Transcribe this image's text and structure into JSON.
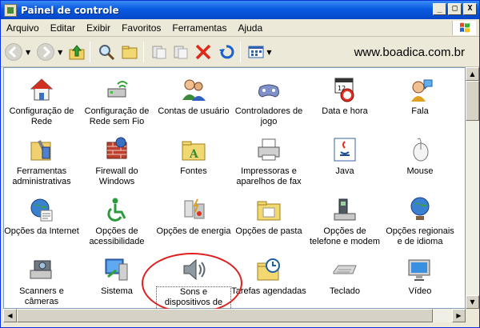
{
  "window": {
    "title": "Painel de controle",
    "minimize": "_",
    "maximize": "□",
    "close": "X"
  },
  "menu": [
    "Arquivo",
    "Editar",
    "Exibir",
    "Favoritos",
    "Ferramentas",
    "Ajuda"
  ],
  "watermark": "www.boadica.com.br",
  "colors": {
    "title_bar": "#0a5ae0",
    "highlight_circle": "#e02020"
  },
  "items": [
    {
      "label": "Configuração de Rede",
      "icon": "network-house-icon"
    },
    {
      "label": "Configuração de Rede sem Fio",
      "icon": "wireless-network-icon"
    },
    {
      "label": "Contas de usuário",
      "icon": "users-icon"
    },
    {
      "label": "Controladores de jogo",
      "icon": "gamepad-icon"
    },
    {
      "label": "Data e hora",
      "icon": "calendar-clock-icon"
    },
    {
      "label": "Fala",
      "icon": "speech-icon"
    },
    {
      "label": "Ferramentas administrativas",
      "icon": "admin-tools-icon"
    },
    {
      "label": "Firewall do Windows",
      "icon": "firewall-icon"
    },
    {
      "label": "Fontes",
      "icon": "fonts-folder-icon"
    },
    {
      "label": "Impressoras e aparelhos de fax",
      "icon": "printer-icon"
    },
    {
      "label": "Java",
      "icon": "java-icon"
    },
    {
      "label": "Mouse",
      "icon": "mouse-icon"
    },
    {
      "label": "Opções da Internet",
      "icon": "internet-globe-icon"
    },
    {
      "label": "Opções de acessibilidade",
      "icon": "accessibility-icon"
    },
    {
      "label": "Opções de energia",
      "icon": "power-icon"
    },
    {
      "label": "Opções de pasta",
      "icon": "folder-options-icon"
    },
    {
      "label": "Opções de telefone e modem",
      "icon": "phone-modem-icon"
    },
    {
      "label": "Opções regionais e de idioma",
      "icon": "regional-globe-icon"
    },
    {
      "label": "Scanners e câmeras",
      "icon": "scanner-camera-icon"
    },
    {
      "label": "Sistema",
      "icon": "system-icon"
    },
    {
      "label": "Sons e dispositivos de áudio",
      "icon": "speaker-icon"
    },
    {
      "label": "Tarefas agendadas",
      "icon": "scheduled-tasks-icon"
    },
    {
      "label": "Teclado",
      "icon": "keyboard-icon"
    },
    {
      "label": "Vídeo",
      "icon": "display-icon"
    }
  ]
}
